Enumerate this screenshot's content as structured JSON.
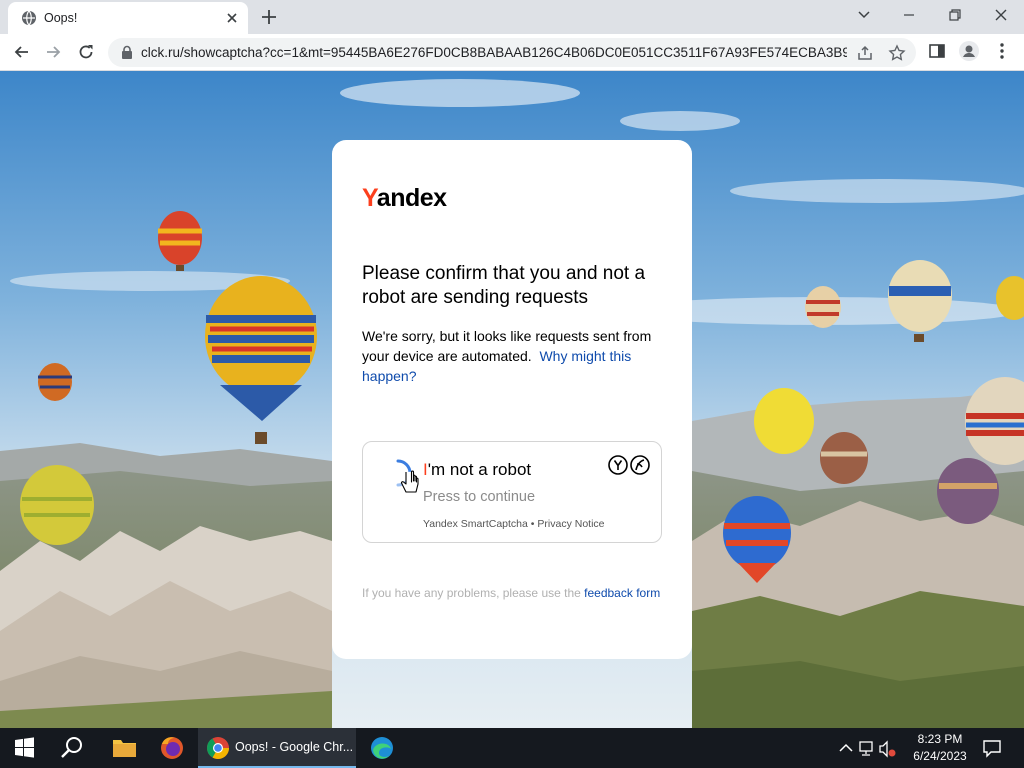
{
  "browser": {
    "tab_title": "Oops!",
    "url": "clck.ru/showcaptcha?cc=1&mt=95445BA6E276FD0CB8BABAAB126C4B06DC0E051CC3511F67A93FE574ECBA3B9..."
  },
  "card": {
    "logo_first": "Y",
    "logo_rest": "andex",
    "heading": "Please confirm that you and not a robot are sending requests",
    "description": "We're sorry, but it looks like requests sent from your device are automated.",
    "why_link": "Why might this happen?",
    "captcha": {
      "label_first": "I",
      "label_rest": "'m not a robot",
      "press_label": "Press to continue",
      "footer_brand": "Yandex SmartCaptcha",
      "footer_sep": " • ",
      "footer_privacy": "Privacy Notice"
    },
    "feedback_text": "If you have any problems, please use the",
    "feedback_link": "feedback form"
  },
  "taskbar": {
    "chrome_label": "Oops! - Google Chr...",
    "time": "8:23 PM",
    "date": "6/24/2023"
  },
  "colors": {
    "yandex_red": "#fc3f1d",
    "link_blue": "#0f4bac",
    "taskbar": "#15191f"
  }
}
